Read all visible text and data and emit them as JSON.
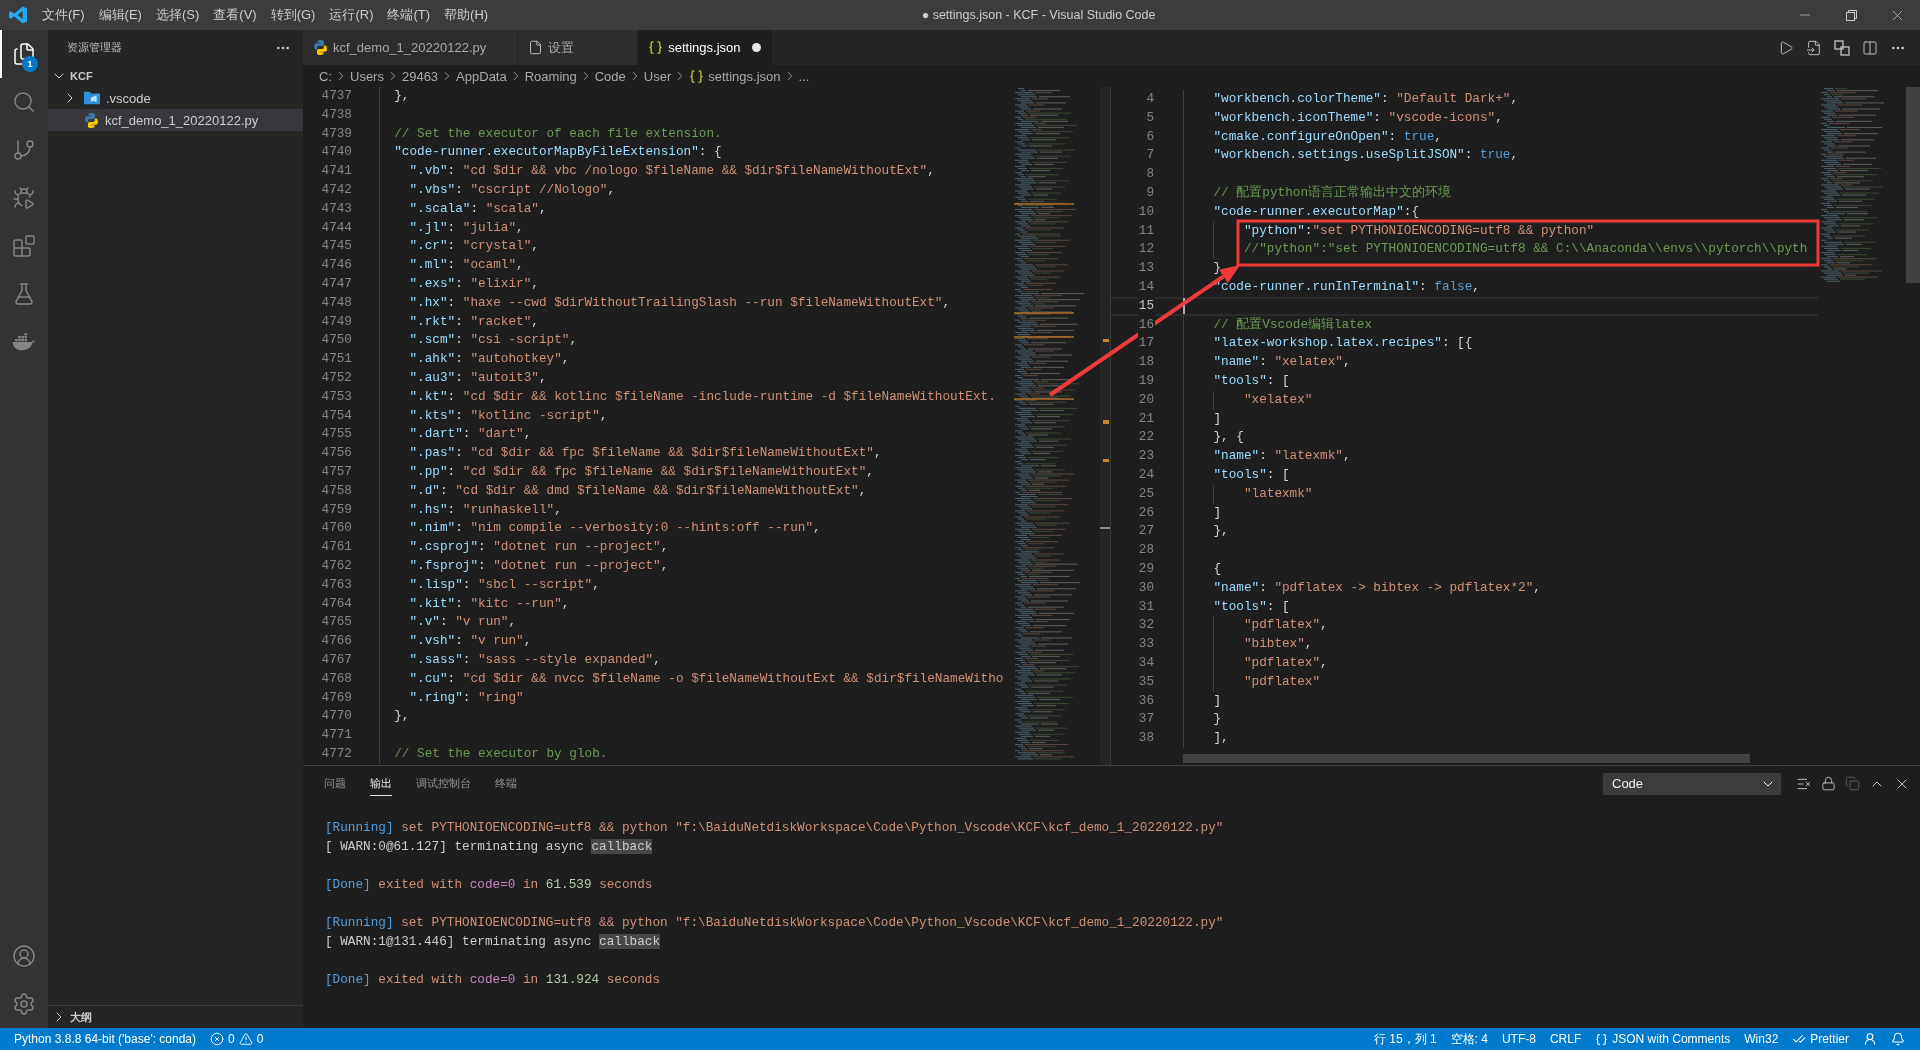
{
  "title_bar": {
    "menus": [
      "文件(F)",
      "编辑(E)",
      "选择(S)",
      "查看(V)",
      "转到(G)",
      "运行(R)",
      "终端(T)",
      "帮助(H)"
    ],
    "title": "● settings.json - KCF - Visual Studio Code"
  },
  "activity_bar": {
    "items": [
      {
        "kind": "explorer",
        "selected": true,
        "badge": "1"
      },
      {
        "kind": "search",
        "selected": false
      },
      {
        "kind": "source-control",
        "selected": false
      },
      {
        "kind": "run",
        "selected": false
      },
      {
        "kind": "extensions",
        "selected": false
      },
      {
        "kind": "testing",
        "selected": false
      },
      {
        "kind": "docker",
        "selected": false
      }
    ],
    "bottom": [
      {
        "kind": "accounts"
      },
      {
        "kind": "manage"
      }
    ]
  },
  "sidebar": {
    "title": "资源管理器",
    "folder": {
      "label": "KCF",
      "expanded": true,
      "children": [
        {
          "label": ".vscode",
          "kind": "folder",
          "expanded": false,
          "selected": false
        },
        {
          "label": "kcf_demo_1_20220122.py",
          "kind": "python",
          "selected": true
        }
      ]
    },
    "outline": {
      "label": "大纲",
      "expanded": false
    }
  },
  "tabs": [
    {
      "label": "kcf_demo_1_20220122.py",
      "kind": "python",
      "selected": false,
      "modified": false
    },
    {
      "label": "设置",
      "kind": "settings",
      "selected": false,
      "modified": false
    },
    {
      "label": "settings.json",
      "kind": "json",
      "selected": true,
      "modified": true
    }
  ],
  "breadcrumb": [
    {
      "label": "C:"
    },
    {
      "label": "Users"
    },
    {
      "label": "29463"
    },
    {
      "label": "AppData"
    },
    {
      "label": "Roaming"
    },
    {
      "label": "Code"
    },
    {
      "label": "User"
    },
    {
      "label": "settings.json",
      "kind": "json"
    },
    {
      "label": "..."
    }
  ],
  "editor": {
    "left": {
      "lines": [
        {
          "number": "4737",
          "text": "  },"
        },
        {
          "number": "4738"
        },
        {
          "number": "4739",
          "text": "  // Set the executor of each file extension."
        },
        {
          "number": "4740",
          "text": "  \"code-runner.executorMapByFileExtension\": {"
        },
        {
          "number": "4741",
          "text": "    \".vb\": \"cd $dir && vbc /nologo $fileName && $dir$fileNameWithoutExt\","
        },
        {
          "number": "4742",
          "text": "    \".vbs\": \"cscript //Nologo\","
        },
        {
          "number": "4743",
          "text": "    \".scala\": \"scala\","
        },
        {
          "number": "4744",
          "text": "    \".jl\": \"julia\","
        },
        {
          "number": "4745",
          "text": "    \".cr\": \"crystal\","
        },
        {
          "number": "4746",
          "text": "    \".ml\": \"ocaml\","
        },
        {
          "number": "4747",
          "text": "    \".exs\": \"elixir\","
        },
        {
          "number": "4748",
          "text": "    \".hx\": \"haxe --cwd $dirWithoutTrailingSlash --run $fileNameWithoutExt\","
        },
        {
          "number": "4749",
          "text": "    \".rkt\": \"racket\","
        },
        {
          "number": "4750",
          "text": "    \".scm\": \"csi -script\","
        },
        {
          "number": "4751",
          "text": "    \".ahk\": \"autohotkey\","
        },
        {
          "number": "4752",
          "text": "    \".au3\": \"autoit3\","
        },
        {
          "number": "4753",
          "text": "    \".kt\": \"cd $dir && kotlinc $fileName -include-runtime -d $fileNameWithoutExt."
        },
        {
          "number": "4754",
          "text": "    \".kts\": \"kotlinc -script\","
        },
        {
          "number": "4755",
          "text": "    \".dart\": \"dart\","
        },
        {
          "number": "4756",
          "text": "    \".pas\": \"cd $dir && fpc $fileName && $dir$fileNameWithoutExt\","
        },
        {
          "number": "4757",
          "text": "    \".pp\": \"cd $dir && fpc $fileName && $dir$fileNameWithoutExt\","
        },
        {
          "number": "4758",
          "text": "    \".d\": \"cd $dir && dmd $fileName && $dir$fileNameWithoutExt\","
        },
        {
          "number": "4759",
          "text": "    \".hs\": \"runhaskell\","
        },
        {
          "number": "4760",
          "text": "    \".nim\": \"nim compile --verbosity:0 --hints:off --run\","
        },
        {
          "number": "4761",
          "text": "    \".csproj\": \"dotnet run --project\","
        },
        {
          "number": "4762",
          "text": "    \".fsproj\": \"dotnet run --project\","
        },
        {
          "number": "4763",
          "text": "    \".lisp\": \"sbcl --script\","
        },
        {
          "number": "4764",
          "text": "    \".kit\": \"kitc --run\","
        },
        {
          "number": "4765",
          "text": "    \".v\": \"v run\","
        },
        {
          "number": "4766",
          "text": "    \".vsh\": \"v run\","
        },
        {
          "number": "4767",
          "text": "    \".sass\": \"sass --style expanded\","
        },
        {
          "number": "4768",
          "text": "    \".cu\": \"cd $dir && nvcc $fileName -o $fileNameWithoutExt && $dir$fileNameWitho"
        },
        {
          "number": "4769",
          "text": "    \".ring\": \"ring\""
        },
        {
          "number": "4770",
          "text": "  },"
        },
        {
          "number": "4771"
        },
        {
          "number": "4772",
          "text": "  // Set the executor by glob."
        }
      ]
    },
    "right": {
      "lines": [
        {
          "number": "4",
          "text": "    \"workbench.colorTheme\": \"Default Dark+\",",
          "current": false
        },
        {
          "number": "5",
          "text": "    \"workbench.iconTheme\": \"vscode-icons\",",
          "current": false
        },
        {
          "number": "6",
          "text": "    \"cmake.configureOnOpen\": true,",
          "current": false
        },
        {
          "number": "7",
          "text": "    \"workbench.settings.useSplitJSON\": true,",
          "current": false
        },
        {
          "number": "8",
          "current": false
        },
        {
          "number": "9",
          "text": "    // 配置python语言正常输出中文的环境",
          "current": false
        },
        {
          "number": "10",
          "text": "    \"code-runner.executorMap\":{",
          "current": false
        },
        {
          "number": "11",
          "text": "        \"python\":\"set PYTHONIOENCODING=utf8 && python\"",
          "current": false
        },
        {
          "number": "12",
          "text": "        //\"python\":\"set PYTHONIOENCODING=utf8 && C:\\\\Anaconda\\\\envs\\\\pytorch\\\\pyth",
          "current": false
        },
        {
          "number": "13",
          "text": "    }",
          "current": false
        },
        {
          "number": "14",
          "text": "    \"code-runner.runInTerminal\": false,",
          "current": false
        },
        {
          "number": "15",
          "current": true
        },
        {
          "number": "16",
          "text": "    // 配置Vscode编辑latex",
          "current": false
        },
        {
          "number": "17",
          "text": "    \"latex-workshop.latex.recipes\": [{",
          "current": false
        },
        {
          "number": "18",
          "text": "    \"name\": \"xelatex\",",
          "current": false
        },
        {
          "number": "19",
          "text": "    \"tools\": [",
          "current": false
        },
        {
          "number": "20",
          "text": "        \"xelatex\"",
          "current": false
        },
        {
          "number": "21",
          "text": "    ]",
          "current": false
        },
        {
          "number": "22",
          "text": "    }, {",
          "current": false
        },
        {
          "number": "23",
          "text": "    \"name\": \"latexmk\",",
          "current": false
        },
        {
          "number": "24",
          "text": "    \"tools\": [",
          "current": false
        },
        {
          "number": "25",
          "text": "        \"latexmk\"",
          "current": false
        },
        {
          "number": "26",
          "text": "    ]",
          "current": false
        },
        {
          "number": "27",
          "text": "    },",
          "current": false
        },
        {
          "number": "28",
          "current": false
        },
        {
          "number": "29",
          "text": "    {",
          "current": false
        },
        {
          "number": "30",
          "text": "    \"name\": \"pdflatex -> bibtex -> pdflatex*2\",",
          "current": false
        },
        {
          "number": "31",
          "text": "    \"tools\": [",
          "current": false
        },
        {
          "number": "32",
          "text": "        \"pdflatex\",",
          "current": false
        },
        {
          "number": "33",
          "text": "        \"bibtex\",",
          "current": false
        },
        {
          "number": "34",
          "text": "        \"pdflatex\",",
          "current": false
        },
        {
          "number": "35",
          "text": "        \"pdflatex\"",
          "current": false
        },
        {
          "number": "36",
          "text": "    ]",
          "current": false
        },
        {
          "number": "37",
          "text": "    }",
          "current": false
        },
        {
          "number": "38",
          "text": "    ],",
          "current": false
        }
      ]
    }
  },
  "panel": {
    "tabs": [
      {
        "label": "问题",
        "selected": false
      },
      {
        "label": "输出",
        "selected": true
      },
      {
        "label": "调试控制台",
        "selected": false
      },
      {
        "label": "终端",
        "selected": false
      }
    ],
    "channel": "Code",
    "output": [
      {
        "lines": [
          {
            "segments": [
              {
                "text": "[Running]",
                "kind": "tag"
              },
              {
                "text": " set PYTHONIOENCODING=utf8 && python \"f:\\BaiduNetdiskWorkspace\\Code\\Python_Vscode\\KCF\\kcf_demo_1_20220122.py\"",
                "kind": "command"
              }
            ]
          },
          {
            "segments": [
              {
                "text": "[ WARN:0@61.127] terminating async ",
                "kind": "plain"
              },
              {
                "text": "callback",
                "kind": "highlight"
              }
            ]
          }
        ]
      },
      {
        "lines": [
          {
            "segments": [
              {
                "text": "[Done]",
                "kind": "tag"
              },
              {
                "text": " exited with ",
                "kind": "command"
              },
              {
                "text": "code=0",
                "kind": "code"
              },
              {
                "text": " in ",
                "kind": "command"
              },
              {
                "text": "61.539",
                "kind": "number"
              },
              {
                "text": " seconds",
                "kind": "command"
              }
            ]
          }
        ]
      },
      {
        "lines": [
          {
            "segments": [
              {
                "text": "[Running]",
                "kind": "tag"
              },
              {
                "text": " set PYTHONIOENCODING=utf8 && python \"f:\\BaiduNetdiskWorkspace\\Code\\Python_Vscode\\KCF\\kcf_demo_1_20220122.py\"",
                "kind": "command"
              }
            ]
          },
          {
            "segments": [
              {
                "text": "[ WARN:1@131.446] terminating async ",
                "kind": "plain"
              },
              {
                "text": "callback",
                "kind": "highlight"
              }
            ]
          }
        ]
      },
      {
        "lines": [
          {
            "segments": [
              {
                "text": "[Done]",
                "kind": "tag"
              },
              {
                "text": " exited with ",
                "kind": "command"
              },
              {
                "text": "code=0",
                "kind": "code"
              },
              {
                "text": " in ",
                "kind": "command"
              },
              {
                "text": "131.924",
                "kind": "number"
              },
              {
                "text": " seconds",
                "kind": "command"
              }
            ]
          }
        ]
      }
    ]
  },
  "status_bar": {
    "left": [
      {
        "kind": "interpreter",
        "label": "Python 3.8.8 64-bit ('base': conda)"
      },
      {
        "kind": "problems",
        "errors": "0",
        "warnings": "0"
      }
    ],
    "right": [
      {
        "kind": "text",
        "label": "行 15，列 1"
      },
      {
        "kind": "text",
        "label": "空格: 4"
      },
      {
        "kind": "text",
        "label": "UTF-8"
      },
      {
        "kind": "text",
        "label": "CRLF"
      },
      {
        "kind": "language",
        "label": "JSON with Comments"
      },
      {
        "kind": "text",
        "label": "Win32"
      },
      {
        "kind": "prettier",
        "label": "Prettier"
      },
      {
        "kind": "feedback"
      },
      {
        "kind": "notifications"
      }
    ]
  }
}
